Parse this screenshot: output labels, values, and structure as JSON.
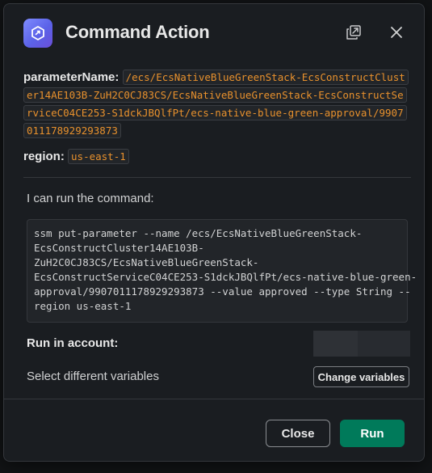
{
  "modal": {
    "title": "Command Action"
  },
  "params": {
    "parameter_name_label": "parameterName:",
    "parameter_name_value": "/ecs/EcsNativeBlueGreenStack-EcsConstructCluster14AE103B-ZuH2C0CJ83CS/EcsNativeBlueGreenStack-EcsConstructServiceC04CE253-S1dckJBQlfPt/ecs-native-blue-green-approval/9907011178929293873",
    "region_label": "region:",
    "region_value": "us-east-1"
  },
  "command": {
    "intro": "I can run the command:",
    "text": "ssm put-parameter --name /ecs/EcsNativeBlueGreenStack-\nEcsConstructCluster14AE103B-\nZuH2C0CJ83CS/EcsNativeBlueGreenStack-\nEcsConstructServiceC04CE253-S1dckJBQlfPt/ecs-native-blue-green-\napproval/9907011178929293873 --value approved --type String --\nregion us-east-1"
  },
  "account": {
    "label": "Run in account:"
  },
  "variables": {
    "label": "Select different variables",
    "change_button": "Change variables"
  },
  "footer": {
    "close_label": "Close",
    "run_label": "Run"
  },
  "colors": {
    "accent_run": "#007a5a",
    "inline_code": "#e8912d",
    "app_icon": "#6a6ff0"
  },
  "icons": {
    "app": "app-logo-icon",
    "popout": "popout-icon",
    "close": "close-icon"
  }
}
